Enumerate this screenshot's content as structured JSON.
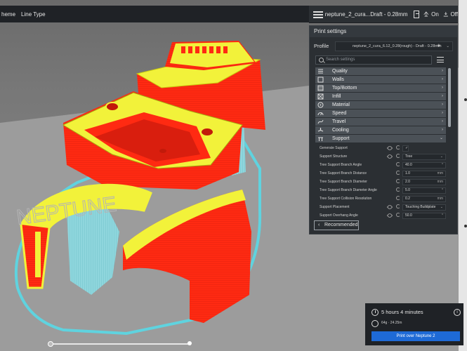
{
  "viewbar": {
    "scheme_label": "heme",
    "line_type_label": "Line Type"
  },
  "printer": {
    "name": "neptune_2_cura...Draft - 0.28mm",
    "support_label": "On",
    "adhesion_label": "Off"
  },
  "print_settings": {
    "title": "Print settings",
    "profile_label": "Profile",
    "profile_value": "neptune_2_cura_6.12_0.28(rough) - Draft - 0.28mm",
    "search_placeholder": "Search settings",
    "categories": [
      {
        "label": "Quality",
        "icon": "quality-icon"
      },
      {
        "label": "Walls",
        "icon": "walls-icon"
      },
      {
        "label": "Top/Bottom",
        "icon": "top-bottom-icon"
      },
      {
        "label": "Infill",
        "icon": "infill-icon"
      },
      {
        "label": "Material",
        "icon": "material-icon"
      },
      {
        "label": "Speed",
        "icon": "speed-icon"
      },
      {
        "label": "Travel",
        "icon": "travel-icon"
      },
      {
        "label": "Cooling",
        "icon": "cooling-icon"
      },
      {
        "label": "Support",
        "icon": "support-icon"
      }
    ],
    "settings": [
      {
        "name": "Generate Support",
        "value": "",
        "unit": "",
        "type": "check"
      },
      {
        "name": "Support Structure",
        "value": "Tree",
        "unit": "",
        "type": "select"
      },
      {
        "name": "Tree Support Branch Angle",
        "value": "40.0",
        "unit": "°",
        "type": "number"
      },
      {
        "name": "Tree Support Branch Distance",
        "value": "1.0",
        "unit": "mm",
        "type": "number"
      },
      {
        "name": "Tree Support Branch Diameter",
        "value": "2.0",
        "unit": "mm",
        "type": "number"
      },
      {
        "name": "Tree Support Branch Diameter Angle",
        "value": "5.0",
        "unit": "°",
        "type": "number"
      },
      {
        "name": "Tree Support Collision Resolution",
        "value": "0.2",
        "unit": "mm",
        "type": "number"
      },
      {
        "name": "Support Placement",
        "value": "Touching Buildplate",
        "unit": "",
        "type": "select"
      },
      {
        "name": "Support Overhang Angle",
        "value": "50.0",
        "unit": "°",
        "type": "number"
      }
    ],
    "recommended_label": "Recommended"
  },
  "estimate": {
    "time": "5 hours 4 minutes",
    "material": "64g · 24.25m",
    "print_button": "Print over Neptune 2"
  }
}
